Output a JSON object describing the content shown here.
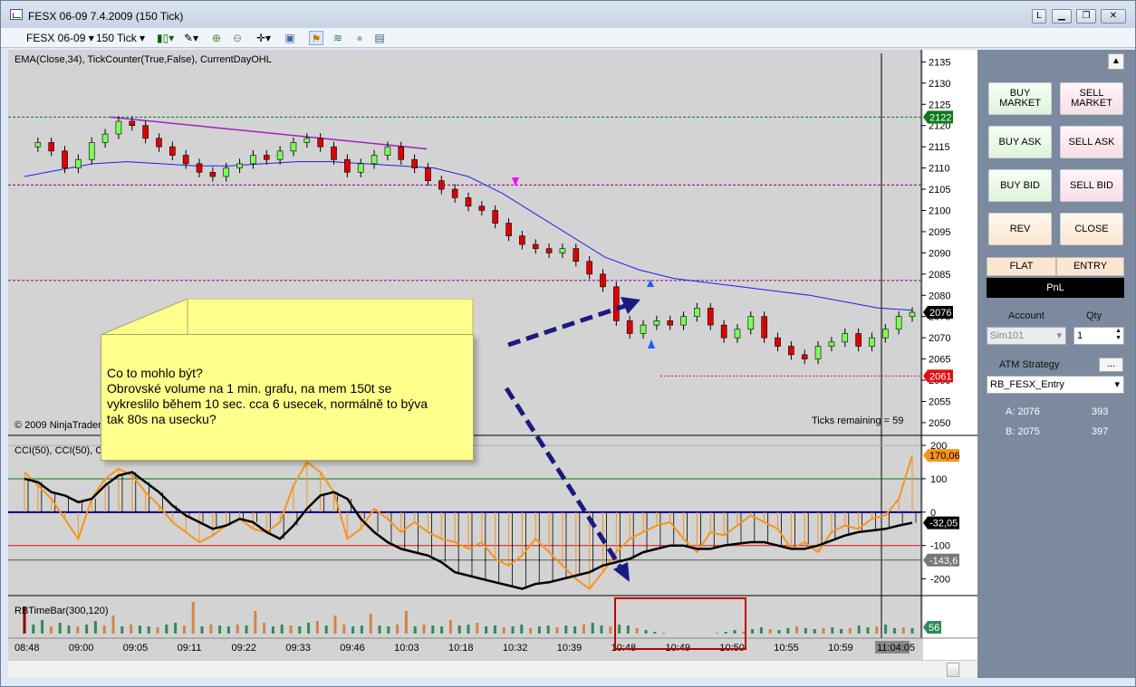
{
  "window": {
    "title": "FESX 06-09  7.4.2009 (150 Tick)",
    "buttons": [
      "L",
      "",
      "",
      ""
    ]
  },
  "toolbar": {
    "instrument": "FESX 06-09",
    "period": "150 Tick",
    "icons": [
      "bars-icon",
      "pencil-icon",
      "zoom-in-icon",
      "zoom-out-icon",
      "crosshair-icon",
      "properties-icon",
      "strategy-icon",
      "indicator-icon",
      "circle-icon",
      "data-box-icon"
    ]
  },
  "chart": {
    "indicator_label": "EMA(Close,34), TickCounter(True,False), CurrentDayOHL",
    "copyright": "© 2009 NinjaTrader",
    "ticks_remaining": "Ticks remaining = 59",
    "price_ticks": [
      "2135",
      "2130",
      "2125",
      "2120",
      "2115",
      "2110",
      "2105",
      "2100",
      "2095",
      "2090",
      "2085",
      "2080",
      "2075",
      "2070",
      "2065",
      "2060",
      "2055",
      "2050"
    ],
    "price_badges": [
      {
        "label": "2122",
        "color": "#0a7a1a"
      },
      {
        "label": "2076",
        "color": "#000000"
      },
      {
        "label": "2061",
        "color": "#e01010"
      }
    ],
    "cci_label": "CCI(50), CCI(50), C",
    "cci_ticks": [
      "200",
      "100",
      "0",
      "-100",
      "-200"
    ],
    "cci_badges": [
      {
        "label": "170,06",
        "color": "#f7941d"
      },
      {
        "label": "-32,05",
        "color": "#000000"
      },
      {
        "label": "-143,6",
        "color": "#777777"
      }
    ],
    "volume_label": "RBTimeBar(300,120)",
    "volume_badge": {
      "label": "56",
      "color": "#2e8b57"
    },
    "time_labels": [
      "08:48",
      "09:00",
      "09:05",
      "09:11",
      "09:22",
      "09:33",
      "09:46",
      "10:03",
      "10:18",
      "10:32",
      "10:39",
      "10:48",
      "10:49",
      "10:50",
      "10:55",
      "10:59",
      "11:04:05"
    ]
  },
  "note": {
    "lines": [
      "Co to mohlo být?",
      "Obrovské volume na 1 min. grafu, na mem 150t se",
      "vykreslilo během 10 sec. cca 6 usecek, normálně to býva",
      "tak 80s na usecku?"
    ]
  },
  "panel": {
    "buy_market": "BUY\nMARKET",
    "sell_market": "SELL\nMARKET",
    "buy_ask": "BUY ASK",
    "sell_ask": "SELL ASK",
    "buy_bid": "BUY BID",
    "sell_bid": "SELL BID",
    "rev": "REV",
    "close": "CLOSE",
    "flat": "FLAT",
    "entry": "ENTRY",
    "pnl": "PnL",
    "account_label": "Account",
    "qty_label": "Qty",
    "account_value": "Sim101",
    "qty_value": "1",
    "atm_label": "ATM Strategy",
    "atm_button": "...",
    "atm_value": "RB_FESX_Entry",
    "a_label": "A: 2076",
    "a_value": "393",
    "b_label": "B: 2075",
    "b_value": "397"
  },
  "chart_data": {
    "type": "line",
    "title": "",
    "xlabel": "",
    "ylabel": "",
    "ylim": [
      2047,
      2137
    ],
    "series": [
      {
        "name": "EMA(Close,34)",
        "values": [
          2108,
          2109.5,
          2111,
          2111.5,
          2111,
          2110.5,
          2110.5,
          2111,
          2111.5,
          2111.5,
          2111,
          2110.5,
          2110,
          2108,
          2104,
          2099,
          2094,
          2089,
          2086,
          2084,
          2083,
          2082,
          2081,
          2080,
          2078.5,
          2077,
          2076.5
        ]
      },
      {
        "name": "CurrentDayOHL High",
        "values": [
          2122
        ]
      },
      {
        "name": "CurrentDayOHL Low",
        "values": [
          2061
        ]
      }
    ]
  }
}
